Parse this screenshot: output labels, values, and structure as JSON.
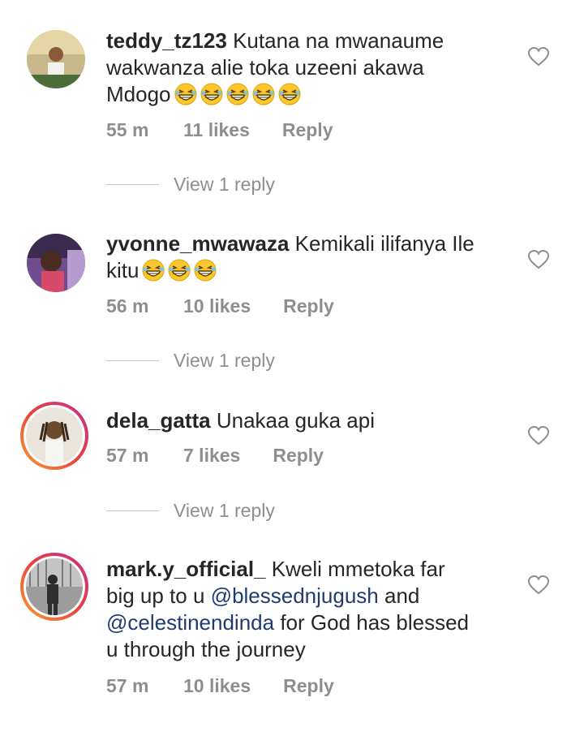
{
  "comments": [
    {
      "username": "teddy_tz123",
      "text_lines": [
        "Kutana na mwanaume",
        "wakwanza alie toka uzeeni akawa",
        "Mdogo"
      ],
      "emoji_count": 5,
      "time": "55 m",
      "likes": "11 likes",
      "reply": "Reply",
      "view_replies": "View 1 reply"
    },
    {
      "username": "yvonne_mwawaza",
      "text_lines": [
        "Kemikali ilifanya Ile",
        "kitu"
      ],
      "emoji_count": 3,
      "time": "56 m",
      "likes": "10 likes",
      "reply": "Reply",
      "view_replies": "View 1 reply"
    },
    {
      "username": "dela_gatta",
      "text_lines": [
        "Unakaa guka api"
      ],
      "time": "57 m",
      "likes": "7 likes",
      "reply": "Reply",
      "view_replies": "View 1 reply"
    },
    {
      "username": "mark.y_official_",
      "text_lines": [
        "Kweli mmetoka far",
        "big up to u",
        "and",
        "for God has blessed",
        "u through the journey"
      ],
      "mentions": [
        "@blessednjugush",
        "@celestinendinda"
      ],
      "time": "57 m",
      "likes": "10 likes",
      "reply": "Reply"
    }
  ],
  "icons": {
    "like": "heart-outline-icon",
    "emoji": "grinning-squinting-face-icon"
  },
  "colors": {
    "text": "#262626",
    "meta": "#8e8e8e",
    "mention": "#1f3b70",
    "story_ring": "#e8413c"
  }
}
